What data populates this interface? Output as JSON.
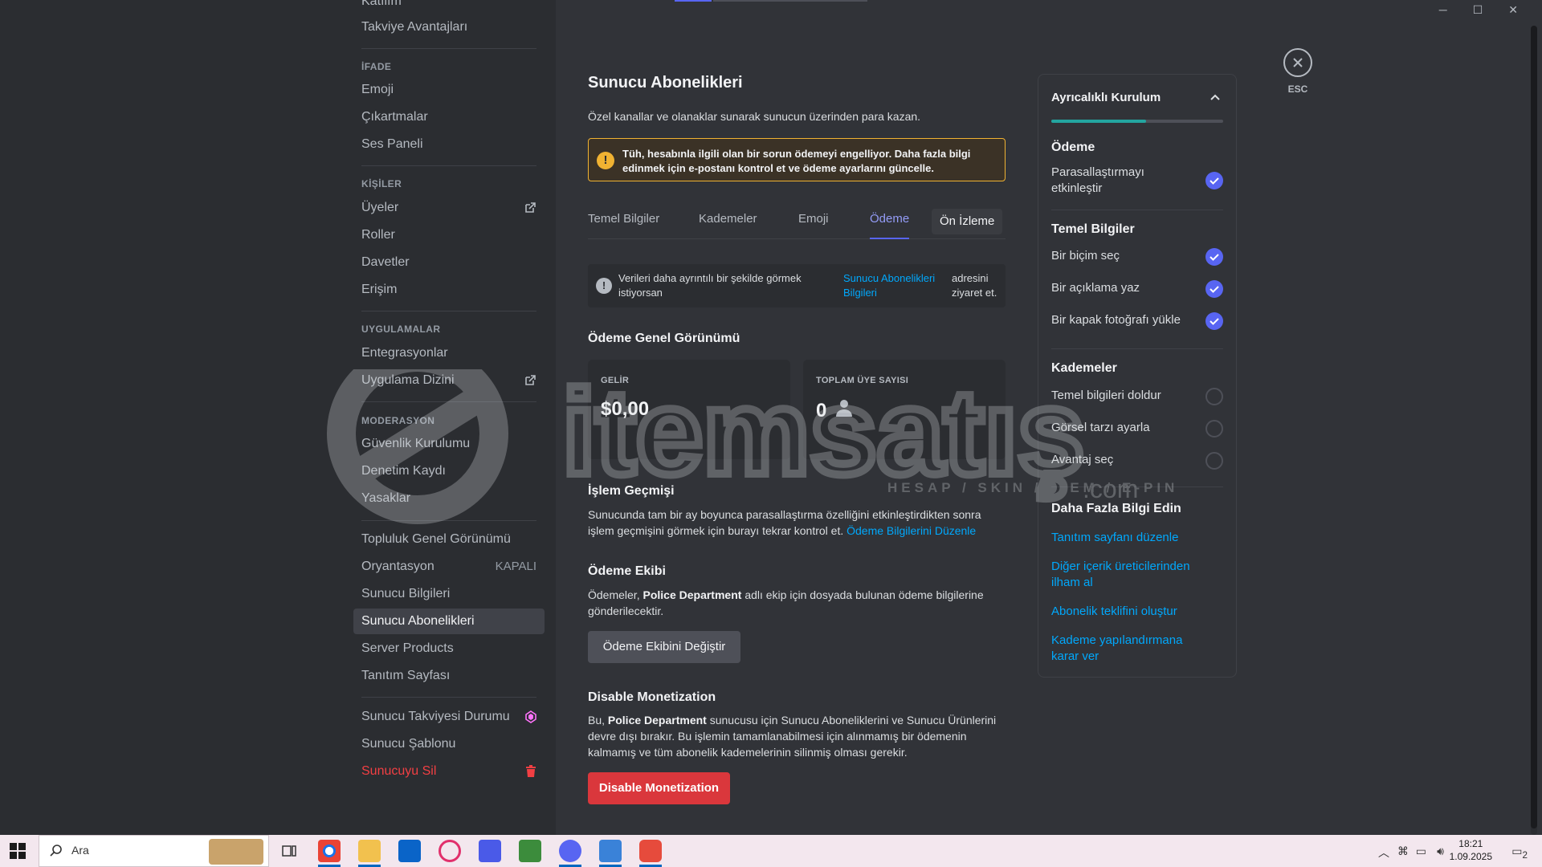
{
  "sidebar": {
    "top_partial": "Katılım",
    "top_item": "Takviye Avantajları",
    "sections": [
      {
        "header": "İFADE",
        "items": [
          "Emoji",
          "Çıkartmalar",
          "Ses Paneli"
        ]
      },
      {
        "header": "KİŞİLER",
        "items": [
          "Üyeler",
          "Roller",
          "Davetler",
          "Erişim"
        ]
      },
      {
        "header": "UYGULAMALAR",
        "items": [
          "Entegrasyonlar",
          "Uygulama Dizini"
        ]
      },
      {
        "header": "MODERASYON",
        "items": [
          "Güvenlik Kurulumu",
          "Denetim Kaydı",
          "Yasaklar"
        ]
      }
    ],
    "group2": [
      "Topluluk Genel Görünümü",
      "Oryantasyon",
      "Sunucu Bilgileri",
      "Sunucu Abonelikleri",
      "Server Products",
      "Tanıtım Sayfası"
    ],
    "oryantasyon_status": "KAPALI",
    "group3": [
      "Sunucu Takviyesi Durumu",
      "Sunucu Şablonu",
      "Sunucuyu Sil"
    ]
  },
  "main": {
    "title": "Sunucu Abonelikleri",
    "subtitle": "Özel kanallar ve olanaklar sunarak sunucun üzerinden para kazan.",
    "warning": "Tüh, hesabınla ilgili olan bir sorun ödemeyi engelliyor. Daha fazla bilgi edinmek için e-postanı kontrol et ve ödeme ayarlarını güncelle.",
    "tabs": [
      "Temel Bilgiler",
      "Kademeler",
      "Emoji",
      "Ödeme",
      "Ön İzleme"
    ],
    "info_text": "Verileri daha ayrıntılı bir şekilde görmek istiyorsan",
    "info_link": "Sunucu Abonelikleri Bilgileri",
    "info_text2": "adresini ziyaret et.",
    "overview_title": "Ödeme Genel Görünümü",
    "cards": [
      {
        "label": "GELİR",
        "value": "$0,00"
      },
      {
        "label": "TOPLAM ÜYE SAYISI",
        "value": "0"
      }
    ],
    "history_title": "İşlem Geçmişi",
    "history_text": "Sunucunda tam bir ay boyunca parasallaştırma özelliğini etkinleştirdikten sonra işlem geçmişini görmek için burayı tekrar kontrol et.",
    "history_link": "Ödeme Bilgilerini Düzenle",
    "team_title": "Ödeme Ekibi",
    "team_text_1": "Ödemeler,",
    "team_name": "Police Department",
    "team_text_2": "adlı ekip için dosyada bulunan ödeme bilgilerine gönderilecektir.",
    "team_button": "Ödeme Ekibini Değiştir",
    "disable_title": "Disable Monetization",
    "disable_text_1": "Bu,",
    "disable_name": "Police Department",
    "disable_text_2": "sunucusu için Sunucu Aboneliklerini ve Sunucu Ürünlerini devre dışı bırakır. Bu işlemin tamamlanabilmesi için alınmamış bir ödemenin kalmamış ve tüm abonelik kademelerinin silinmiş olması gerekir.",
    "disable_button": "Disable Monetization"
  },
  "panel": {
    "title": "Ayrıcalıklı Kurulum",
    "progress": 0.55,
    "sections": [
      {
        "title": "Ödeme",
        "items": [
          {
            "label": "Parasallaştırmayı etkinleştir",
            "done": true
          }
        ]
      },
      {
        "title": "Temel Bilgiler",
        "items": [
          {
            "label": "Bir biçim seç",
            "done": true
          },
          {
            "label": "Bir açıklama yaz",
            "done": true
          },
          {
            "label": "Bir kapak fotoğrafı yükle",
            "done": true
          }
        ]
      },
      {
        "title": "Kademeler",
        "items": [
          {
            "label": "Temel bilgileri doldur",
            "done": false
          },
          {
            "label": "Görsel tarzı ayarla",
            "done": false
          },
          {
            "label": "Avantaj seç",
            "done": false
          }
        ]
      }
    ],
    "learn_title": "Daha Fazla Bilgi Edin",
    "links": [
      "Tanıtım sayfanı düzenle",
      "Diğer içerik üreticilerinden ilham al",
      "Abonelik teklifini oluştur",
      "Kademe yapılandırmana karar ver"
    ]
  },
  "esc_label": "ESC",
  "watermark": {
    "brand": "itemsatış",
    "tagline": "HESAP / SKIN / ITEM / E-PIN",
    "suffix": ".com"
  },
  "taskbar": {
    "search_placeholder": "Ara",
    "time": "18:21",
    "date": "1.09.2025",
    "notifications": "2"
  },
  "colors": {
    "accent": "#5865f2",
    "link": "#00a8fc",
    "danger": "#da373c",
    "warning": "#f0b232",
    "progress": "#23a5a0"
  }
}
